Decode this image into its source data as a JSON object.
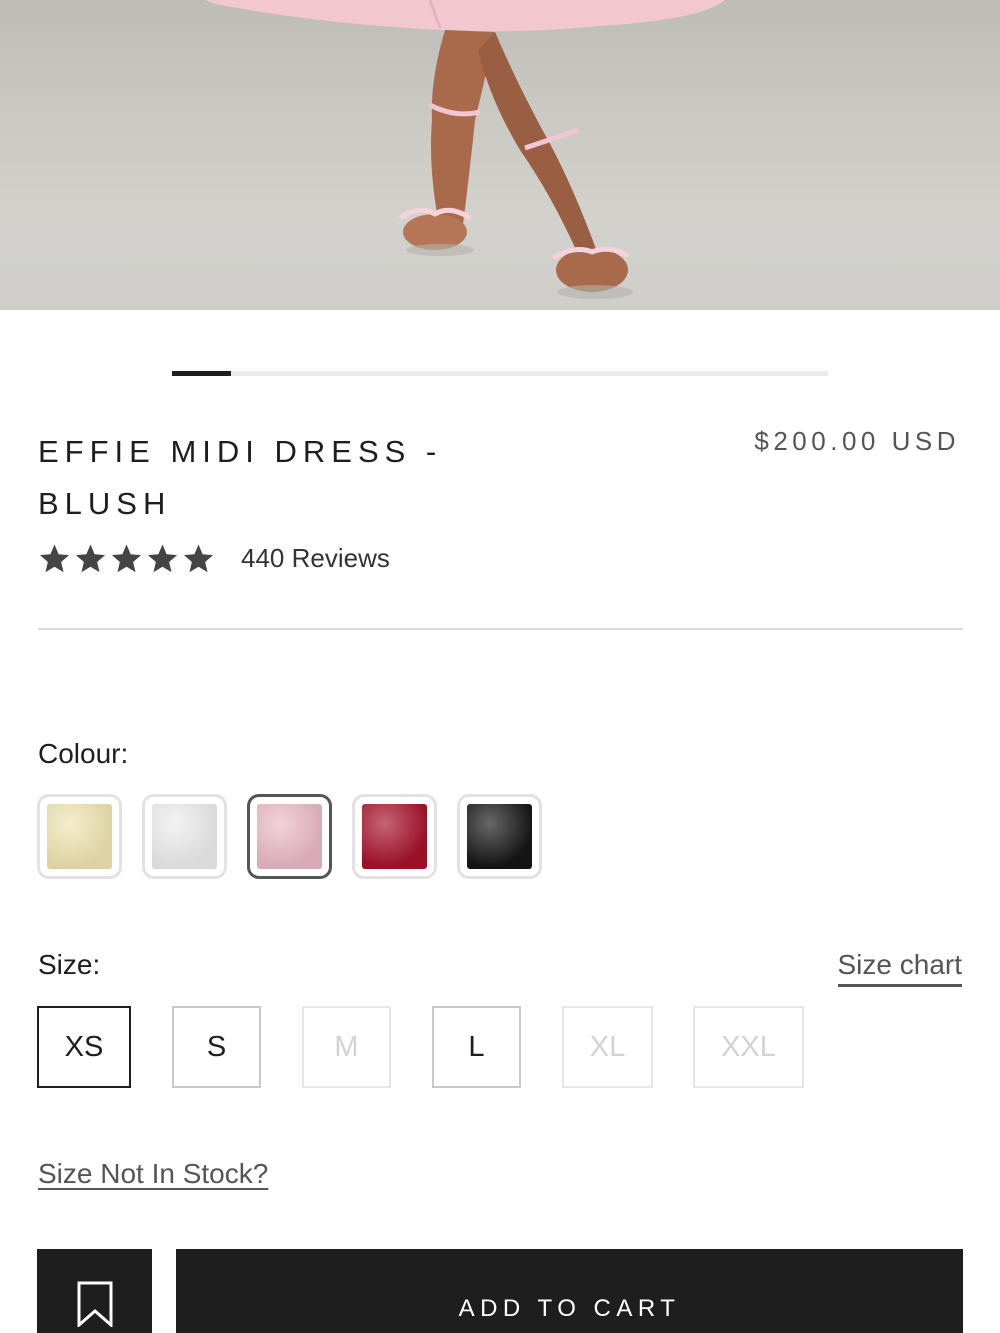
{
  "product": {
    "title": "EFFIE MIDI DRESS - BLUSH",
    "price": "$200.00 USD",
    "rating": 5,
    "reviews_text": "440 Reviews"
  },
  "carousel": {
    "progress": 0.09
  },
  "colour": {
    "label": "Colour:",
    "options": [
      {
        "name": "butter-yellow",
        "color": "#efe4b1"
      },
      {
        "name": "white",
        "color": "#ececec"
      },
      {
        "name": "blush",
        "color": "#eab9c4",
        "selected": true
      },
      {
        "name": "red",
        "color": "#a7112a"
      },
      {
        "name": "black",
        "color": "#161616"
      }
    ]
  },
  "size": {
    "label": "Size:",
    "chart_link": "Size chart",
    "options": [
      "XS",
      "S",
      "M",
      "L",
      "XL",
      "XXL"
    ],
    "selected": "XS",
    "unavailable": [
      "M",
      "XL",
      "XXL"
    ]
  },
  "links": {
    "not_in_stock": "Size Not In Stock?"
  },
  "actions": {
    "add_to_cart": "ADD TO CART",
    "wishlist_icon": "bookmark-icon"
  },
  "colors": {
    "text": "#1e1e1e",
    "muted": "#555555",
    "button_bg": "#1e1e1e",
    "button_text": "#ffffff"
  }
}
